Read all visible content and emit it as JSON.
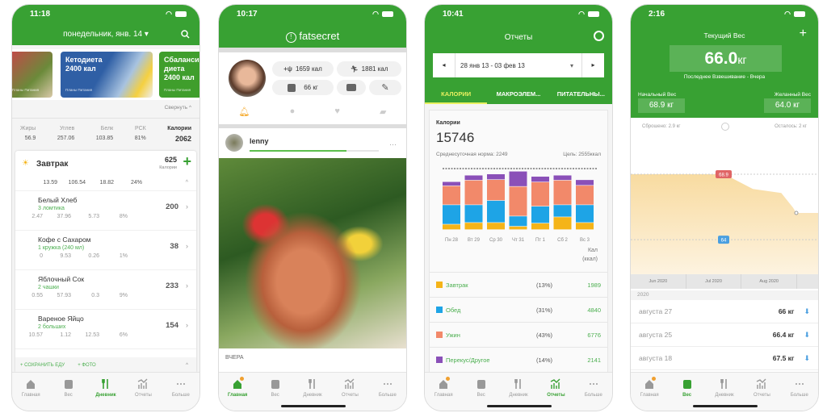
{
  "tabbar": {
    "items": [
      "Главная",
      "Вес",
      "Дневник",
      "Отчеты",
      "Больше"
    ]
  },
  "diary": {
    "status_time": "11:18",
    "title": "понедельник, янв. 14 ▾",
    "carousel": [
      {
        "title": "",
        "source": "Планы Питания"
      },
      {
        "title": "Кетодиета",
        "subtitle": "2400 кал",
        "source": "Планы Питания"
      },
      {
        "title": "Сбаланси",
        "title2": "диета",
        "subtitle": "2400 кал",
        "source": "Планы Питания"
      }
    ],
    "collapse_label": "Свернуть",
    "totals": [
      {
        "label": "Жиры",
        "value": "56.9"
      },
      {
        "label": "Углев",
        "value": "257.06"
      },
      {
        "label": "Белк",
        "value": "103.85"
      },
      {
        "label": "РСК",
        "value": "81%"
      },
      {
        "label": "Калории",
        "value": "2062"
      }
    ],
    "meal": {
      "name": "Завтрак",
      "calories": "625",
      "calories_label": "Калории",
      "macros": [
        "13.59",
        "106.54",
        "18.82",
        "24%"
      ]
    },
    "foods": [
      {
        "name": "Белый Хлеб",
        "portion": "3 ломтика",
        "macros": [
          "2.47",
          "37.96",
          "5.73",
          "8%"
        ],
        "kcal": "200"
      },
      {
        "name": "Кофе с Сахаром",
        "portion": "1 кружка (240 мл)",
        "macros": [
          "0",
          "9.53",
          "0.26",
          "1%"
        ],
        "kcal": "38"
      },
      {
        "name": "Яблочный Сок",
        "portion": "2 чашки",
        "macros": [
          "0.55",
          "57.93",
          "0.3",
          "9%"
        ],
        "kcal": "233"
      },
      {
        "name": "Вареное Яйцо",
        "portion": "2 больших",
        "macros": [
          "10.57",
          "1.12",
          "12.53",
          "6%"
        ],
        "kcal": "154"
      }
    ],
    "save_food": "+ СОХРАНИТЬ ЕДУ",
    "photo": "+ ФОТО",
    "active_tab": 2
  },
  "home": {
    "status_time": "10:17",
    "logo": "fatsecret",
    "stats": {
      "food_kcal": "1659 кал",
      "exercise_kcal": "1881 кал",
      "weight": "66 кг"
    },
    "post": {
      "user": "lenny",
      "progress": 0.75
    },
    "section_label": "ВЧЕРА",
    "active_tab": 0
  },
  "reports": {
    "status_time": "10:41",
    "title": "Отчеты",
    "date_range": "28 янв 13 - 03 фев 13",
    "tabs": [
      "КАЛОРИИ",
      "МАКРОЭЛЕМ...",
      "ПИТАТЕЛЬНЫ..."
    ],
    "active_report_tab": 0,
    "card_title": "Калории",
    "total": "15746",
    "avg_label": "Среднесуточная норма: 2249",
    "goal_label": "Цель: 2555ккал",
    "col_header": [
      "Кал",
      "(ккал)"
    ],
    "rows": [
      {
        "name": "Завтрак",
        "pct": "(13%)",
        "kcal": "1989",
        "color": "#f5b418"
      },
      {
        "name": "Обед",
        "pct": "(31%)",
        "kcal": "4840",
        "color": "#1ea4e6"
      },
      {
        "name": "Ужин",
        "pct": "(43%)",
        "kcal": "6776",
        "color": "#f2896a"
      },
      {
        "name": "Перекус/Другое",
        "pct": "(14%)",
        "kcal": "2141",
        "color": "#8a50b8"
      }
    ],
    "active_tab": 3
  },
  "chart_data": {
    "type": "bar",
    "stacked": true,
    "categories": [
      "Пн 28",
      "Вт 29",
      "Ср 30",
      "Чт 31",
      "Пт 1",
      "Сб 2",
      "Вс 3"
    ],
    "series": [
      {
        "name": "Завтрак",
        "color": "#f5b418",
        "values": [
          225,
          295,
          295,
          140,
          270,
          530,
          295
        ]
      },
      {
        "name": "Обед",
        "color": "#1ea4e6",
        "values": [
          810,
          740,
          920,
          425,
          705,
          505,
          740
        ]
      },
      {
        "name": "Ужин",
        "color": "#f2896a",
        "values": [
          790,
          1025,
          870,
          1235,
          1010,
          1025,
          810
        ]
      },
      {
        "name": "Перекус/Другое",
        "color": "#8a50b8",
        "values": [
          175,
          210,
          235,
          635,
          235,
          210,
          235
        ]
      }
    ],
    "goal_line": 2555,
    "ylim": [
      0,
      2555
    ],
    "grid": false
  },
  "weight": {
    "status_time": "2:16",
    "title": "Текущий Вес",
    "current": "66.0",
    "unit": "кг",
    "last_weigh": "Последнее Взвешивание - Вчера",
    "start_label": "Начальный Вес",
    "start_value": "68.9 кг",
    "goal_label": "Желанный Вес",
    "goal_value": "64.0 кг",
    "lost": "Сброшено: 2.9 кг",
    "left": "Осталось: 2 кг",
    "chart": {
      "start_marker": "68.9",
      "goal_marker": "64",
      "months": [
        "Jun 2020",
        "Jul 2020",
        "Aug 2020"
      ],
      "series": [
        [
          "2020-05-20",
          68.9
        ],
        [
          "2020-07-15",
          68.9
        ],
        [
          "2020-08-01",
          67.8
        ],
        [
          "2020-08-18",
          67.5
        ],
        [
          "2020-08-25",
          66.4
        ],
        [
          "2020-08-27",
          66.0
        ],
        [
          "2020-09-10",
          66.0
        ]
      ]
    },
    "year": "2020",
    "entries": [
      {
        "date": "августа 27",
        "value": "66 кг"
      },
      {
        "date": "августа 25",
        "value": "66.4 кг"
      },
      {
        "date": "августа 18",
        "value": "67.5 кг"
      }
    ],
    "active_tab": 1
  }
}
